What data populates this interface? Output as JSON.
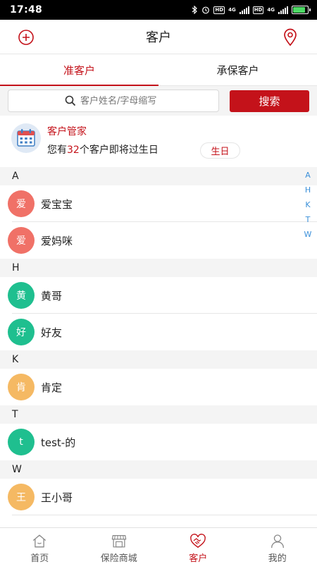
{
  "status_bar": {
    "time": "17:48",
    "badges": [
      "HD",
      "HD"
    ],
    "network": [
      "4G",
      "4G"
    ],
    "battery_level": 0.85
  },
  "header": {
    "title": "客户",
    "left_icon": "add-circle-icon",
    "right_icon": "location-pin-icon"
  },
  "tabs": [
    {
      "label": "准客户",
      "active": true
    },
    {
      "label": "承保客户",
      "active": false
    }
  ],
  "search": {
    "placeholder": "客户姓名/字母缩写",
    "value": "",
    "button_label": "搜索"
  },
  "manager": {
    "icon": "calendar-icon",
    "title": "客户管家",
    "text_prefix": "您有",
    "count": "32",
    "text_suffix": "个客户即将过生日",
    "birthday_button": "生日"
  },
  "sections": [
    {
      "letter": "A",
      "contacts": [
        {
          "initial": "爱",
          "name": "爱宝宝",
          "color": "#f07167"
        },
        {
          "initial": "爱",
          "name": "爱妈咪",
          "color": "#f07167"
        }
      ]
    },
    {
      "letter": "H",
      "contacts": [
        {
          "initial": "黄",
          "name": "黄哥",
          "color": "#1fbf8f"
        },
        {
          "initial": "好",
          "name": "好友",
          "color": "#1fbf8f"
        }
      ]
    },
    {
      "letter": "K",
      "contacts": [
        {
          "initial": "肯",
          "name": "肯定",
          "color": "#f5b963"
        }
      ]
    },
    {
      "letter": "T",
      "contacts": [
        {
          "initial": "t",
          "name": "test-的",
          "color": "#1fbf8f"
        }
      ]
    },
    {
      "letter": "W",
      "contacts": [
        {
          "initial": "王",
          "name": "王小哥",
          "color": "#f5b963"
        }
      ]
    }
  ],
  "index_letters": [
    "A",
    "H",
    "K",
    "T",
    "W"
  ],
  "bottom_nav": [
    {
      "label": "首页",
      "icon": "home-icon",
      "active": false
    },
    {
      "label": "保险商城",
      "icon": "store-icon",
      "active": false
    },
    {
      "label": "客户",
      "icon": "handshake-heart-icon",
      "active": true
    },
    {
      "label": "我的",
      "icon": "person-icon",
      "active": false
    }
  ],
  "colors": {
    "accent": "#c4121a",
    "index": "#3a8fd9",
    "section_bg": "#f4f4f4"
  }
}
